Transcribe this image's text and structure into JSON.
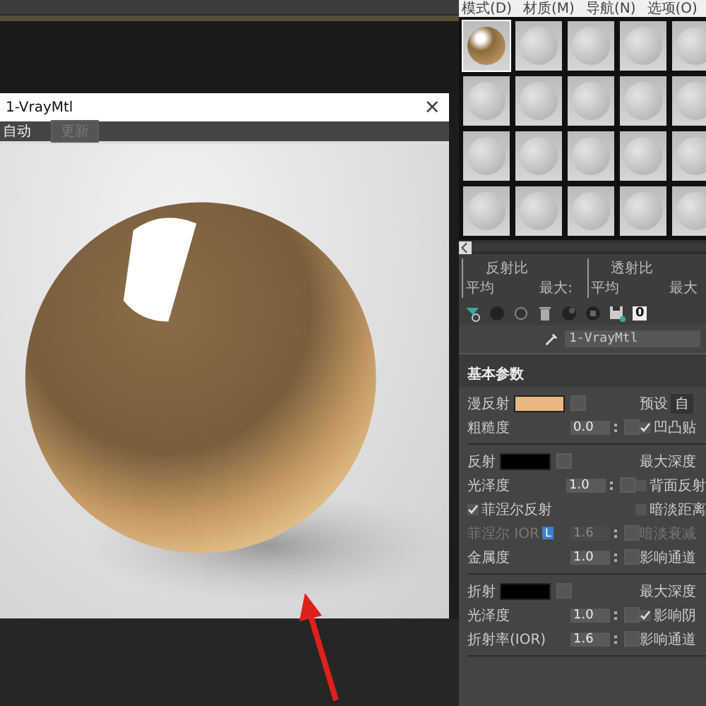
{
  "render_window": {
    "title": "1-VrayMtl",
    "close_glyph": "×",
    "toolbar": [
      {
        "label": "自动",
        "disabled": false
      },
      {
        "label": "更新",
        "disabled": true
      }
    ]
  },
  "material_editor": {
    "menu": [
      "模式(D)",
      "材质(M)",
      "导航(N)",
      "选项(O)"
    ],
    "slots": [
      {
        "kind": "gold",
        "selected": true
      },
      {
        "kind": "default",
        "selected": false
      },
      {
        "kind": "default",
        "selected": false
      },
      {
        "kind": "default",
        "selected": false
      },
      {
        "kind": "default",
        "selected": false
      },
      {
        "kind": "default",
        "selected": false
      },
      {
        "kind": "default",
        "selected": false
      },
      {
        "kind": "default",
        "selected": false
      },
      {
        "kind": "default",
        "selected": false
      },
      {
        "kind": "default",
        "selected": false
      },
      {
        "kind": "default",
        "selected": false
      },
      {
        "kind": "default",
        "selected": false
      },
      {
        "kind": "default",
        "selected": false
      },
      {
        "kind": "default",
        "selected": false
      },
      {
        "kind": "default",
        "selected": false
      },
      {
        "kind": "default",
        "selected": false
      },
      {
        "kind": "default",
        "selected": false
      },
      {
        "kind": "default",
        "selected": false
      },
      {
        "kind": "default",
        "selected": false
      },
      {
        "kind": "default",
        "selected": false
      }
    ],
    "ratios": [
      {
        "title": "反射比",
        "average": "平均",
        "max": "最大:"
      },
      {
        "title": "透射比",
        "average": "平均",
        "max": "最大"
      }
    ],
    "material_id": "0",
    "material_name": "1-VrayMtl",
    "section_title": "基本参数",
    "groups": [
      {
        "rows": [
          {
            "left": {
              "kind": "color",
              "label": "漫反射",
              "color": "#e8b783"
            },
            "right": {
              "kind": "preset",
              "label": "预设",
              "value": "自"
            }
          },
          {
            "left": {
              "kind": "spinner",
              "label": "粗糙度",
              "value": "0.0",
              "disabled": false
            },
            "right": {
              "kind": "checkbox",
              "label": "凹凸贴",
              "checked": true
            }
          }
        ]
      },
      {
        "rows": [
          {
            "left": {
              "kind": "color",
              "label": "反射",
              "color": "#000000"
            },
            "right": {
              "kind": "text",
              "label": "最大深度",
              "disabled": false
            }
          },
          {
            "left": {
              "kind": "spinner",
              "label": "光泽度",
              "value": "1.0",
              "disabled": false
            },
            "right": {
              "kind": "checkbox",
              "label": "背面反射",
              "checked": false
            }
          },
          {
            "left": {
              "kind": "checkbox",
              "label": "菲涅尔反射",
              "checked": true
            },
            "right": {
              "kind": "checkbox",
              "label": "暗淡距离",
              "checked": false
            }
          },
          {
            "left": {
              "kind": "spinner",
              "label": "菲涅尔 IOR",
              "lock": "L",
              "value": "1.6",
              "disabled": true
            },
            "right": {
              "kind": "text",
              "label": "暗淡衰减",
              "disabled": true
            }
          },
          {
            "left": {
              "kind": "spinner",
              "label": "金属度",
              "value": "1.0",
              "disabled": false
            },
            "right": {
              "kind": "text",
              "label": "影响通道",
              "disabled": false
            }
          }
        ]
      },
      {
        "rows": [
          {
            "left": {
              "kind": "color",
              "label": "折射",
              "color": "#000000"
            },
            "right": {
              "kind": "text",
              "label": "最大深度",
              "disabled": false
            }
          },
          {
            "left": {
              "kind": "spinner",
              "label": "光泽度",
              "value": "1.0",
              "disabled": false
            },
            "right": {
              "kind": "checkbox",
              "label": "影响阴",
              "checked": true
            }
          },
          {
            "left": {
              "kind": "spinner",
              "label": "折射率(IOR)",
              "value": "1.6",
              "disabled": false
            },
            "right": {
              "kind": "text",
              "label": "影响通道",
              "disabled": false
            }
          }
        ]
      }
    ]
  }
}
